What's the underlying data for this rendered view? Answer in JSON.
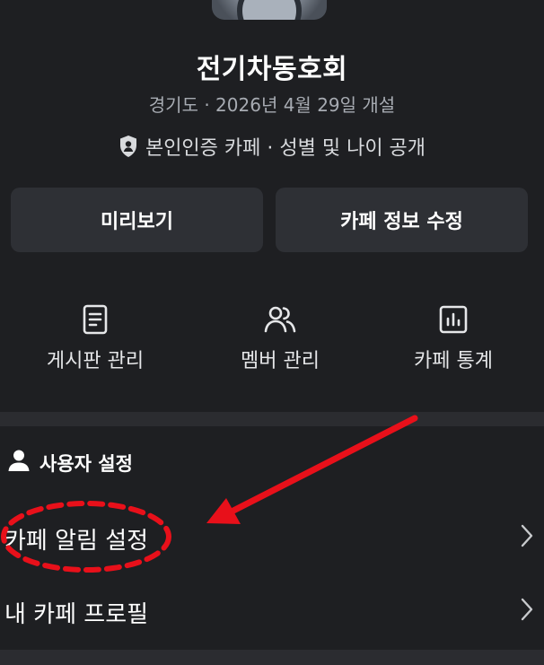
{
  "cafe": {
    "title": "전기차동호회",
    "subtitle": "경기도 · 2026년 4월 29일 개설",
    "verify_text": "본인인증 카페 · 성별 및 나이 공개"
  },
  "buttons": {
    "preview_label": "미리보기",
    "edit_label": "카페 정보 수정"
  },
  "menu": [
    {
      "label": "게시판 관리",
      "icon": "document-icon"
    },
    {
      "label": "멤버 관리",
      "icon": "members-icon"
    },
    {
      "label": "카페 통계",
      "icon": "chart-icon"
    }
  ],
  "user_settings": {
    "title": "사용자 설정",
    "items": [
      {
        "label": "카페 알림 설정"
      },
      {
        "label": "내 카페 프로필"
      }
    ]
  },
  "colors": {
    "background": "#1e1f22",
    "button_bg": "#2e3035",
    "annotation": "#e8101a"
  }
}
